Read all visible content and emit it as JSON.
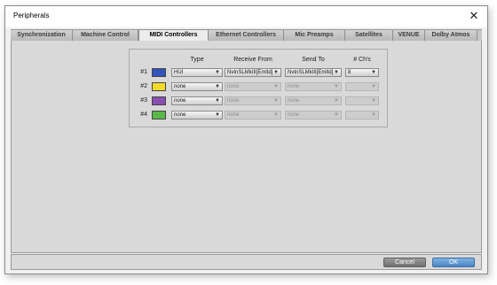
{
  "window": {
    "title": "Peripherals",
    "close_glyph": "✕"
  },
  "tabs": [
    {
      "label": "Synchronization",
      "active": false
    },
    {
      "label": "Machine Control",
      "active": false
    },
    {
      "label": "MIDI Controllers",
      "active": true
    },
    {
      "label": "Ethernet Controllers",
      "active": false
    },
    {
      "label": "Mic Preamps",
      "active": false
    },
    {
      "label": "Satellites",
      "active": false
    },
    {
      "label": "VENUE",
      "active": false
    },
    {
      "label": "Dolby Atmos",
      "active": false
    }
  ],
  "midi": {
    "headers": {
      "type": "Type",
      "receive": "Receive From",
      "send": "Send To",
      "channels": "# Ch's"
    },
    "rows": [
      {
        "label": "#1",
        "color": "#3355bb",
        "type": "HUI",
        "receive": "NvtnSLMkIII[Emltd]",
        "send": "NvtnSLMkIII[Emltd]",
        "channels": "8",
        "enabled": true
      },
      {
        "label": "#2",
        "color": "#f2dc2a",
        "type": "none",
        "receive": "none",
        "send": "none",
        "channels": "",
        "enabled": false
      },
      {
        "label": "#3",
        "color": "#8a4fb0",
        "type": "none",
        "receive": "none",
        "send": "none",
        "channels": "",
        "enabled": false
      },
      {
        "label": "#4",
        "color": "#5ab84a",
        "type": "none",
        "receive": "none",
        "send": "none",
        "channels": "",
        "enabled": false
      }
    ]
  },
  "buttons": {
    "cancel": "Cancel",
    "ok": "OK"
  }
}
